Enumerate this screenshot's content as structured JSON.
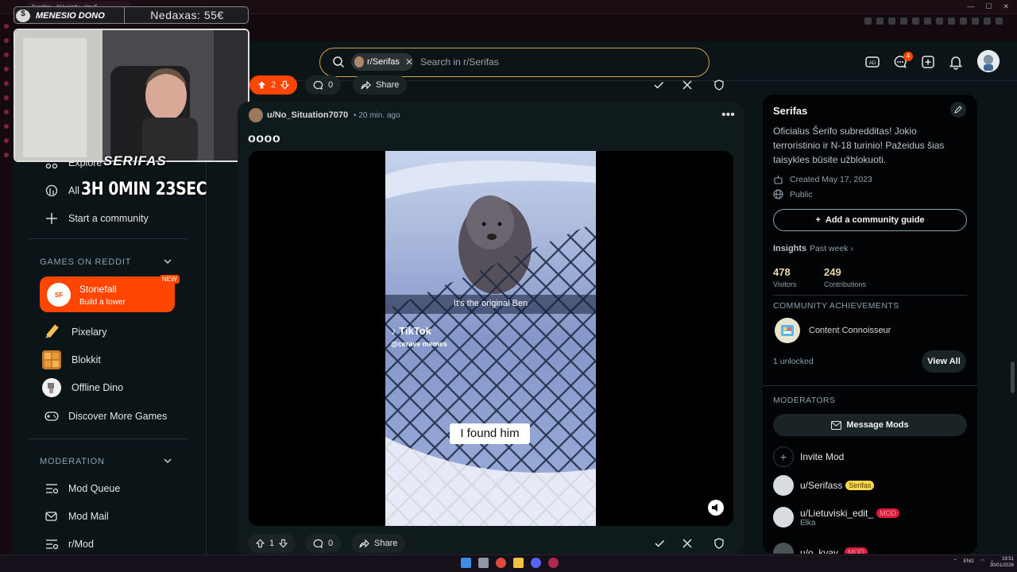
{
  "browser": {
    "tab_title": "Eurofon - Akivaizdu - YouT",
    "minimize": "—",
    "maximize": "☐",
    "close": "✕"
  },
  "overlay": {
    "streamer_name": "MENESIO DONO",
    "balance": "Nedaxas: 55€",
    "channel_name": "SERIFAS",
    "timer": "3H 0MIN 23SEC"
  },
  "search": {
    "community_chip": "r/Serifas",
    "placeholder": "Search in r/Serifas"
  },
  "header": {
    "notification_count": "4"
  },
  "left_nav": {
    "explore": "Explore",
    "all": "All",
    "start_community": "Start a community",
    "games_section": "GAMES ON REDDIT",
    "featured_game": {
      "name": "Stonefall",
      "subtitle": "Build a tower",
      "badge": "NEW",
      "logo": "SF"
    },
    "games": [
      "Pixelary",
      "Blokkit",
      "Offline Dino",
      "Discover More Games"
    ],
    "moderation_section": "MODERATION",
    "moderation": [
      "Mod Queue",
      "Mod Mail",
      "r/Mod"
    ]
  },
  "prev_post": {
    "votes": "2",
    "comments": "0",
    "share": "Share"
  },
  "post": {
    "author": "u/No_Situation7070",
    "time": "• 20 min. ago",
    "title": "oooo",
    "video_caption": "It's the original Ben",
    "watermark": "TikTok",
    "watermark_handle": "@cerave memes",
    "subtitle": "I found him",
    "votes": "1",
    "comments": "0",
    "share": "Share"
  },
  "community": {
    "name": "Serifas",
    "description": "Oficialus Šerifo subredditas! Jokio terroristinio ir N-18 turinio! Pažeidus šias taisykles būsite užblokuoti.",
    "created": "Created May 17, 2023",
    "visibility": "Public",
    "add_guide": "Add a community guide",
    "insights_label": "Insights",
    "insights_range": "Past week",
    "visitors_value": "478",
    "visitors_label": "Visitors",
    "contributions_value": "249",
    "contributions_label": "Contributions",
    "achievements_title": "COMMUNITY ACHIEVEMENTS",
    "achievement_name": "Content Connoisseur",
    "unlocked": "1 unlocked",
    "view_all": "View All",
    "moderators_title": "MODERATORS",
    "message_mods": "Message Mods",
    "invite_mod": "Invite Mod",
    "mods": [
      {
        "name": "u/Serifass",
        "flair": "Serifas",
        "sub": ""
      },
      {
        "name": "u/Lietuviski_edit_",
        "flair": "MOD",
        "sub": "Elka"
      },
      {
        "name": "u/o_kvay",
        "flair": "MOD",
        "sub": ""
      }
    ]
  },
  "taskbar": {
    "lang": "ENG",
    "time": "19:51",
    "date": "30/01/2026"
  },
  "colors": {
    "accent": "#ff4500",
    "search_border": "#d4a14a",
    "upvoted": "#ff4500",
    "page_bg": "#0b1416"
  }
}
